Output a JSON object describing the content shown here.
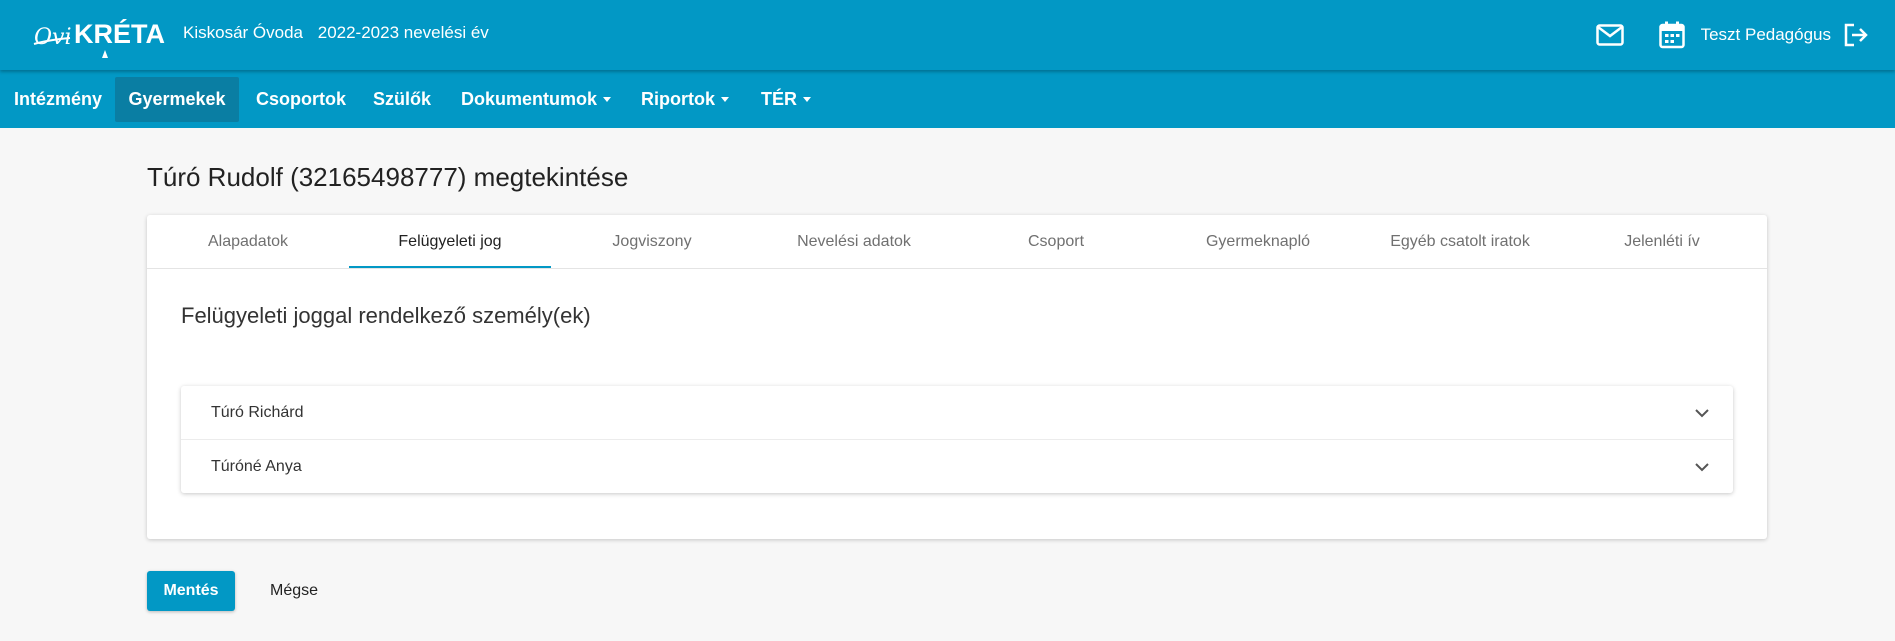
{
  "header": {
    "logo_text": "OviKRÉTA",
    "institution": "Kiskosár Óvoda",
    "school_year": "2022-2023 nevelési év",
    "user_name": "Teszt Pedagógus",
    "icons": [
      "mail-icon",
      "calendar-icon",
      "logout-icon"
    ]
  },
  "nav": {
    "items": [
      {
        "label": "Intézmény"
      },
      {
        "label": "Gyermekek",
        "active": true
      },
      {
        "label": "Csoportok"
      },
      {
        "label": "Szülők"
      },
      {
        "label": "Dokumentumok",
        "dropdown": true
      },
      {
        "label": "Riportok",
        "dropdown": true
      },
      {
        "label": "TÉR",
        "dropdown": true
      }
    ]
  },
  "page": {
    "title": "Túró Rudolf (32165498777) megtekintése"
  },
  "tabs": [
    {
      "label": "Alapadatok"
    },
    {
      "label": "Felügyeleti jog",
      "active": true
    },
    {
      "label": "Jogviszony"
    },
    {
      "label": "Nevelési adatok"
    },
    {
      "label": "Csoport"
    },
    {
      "label": "Gyermeknapló"
    },
    {
      "label": "Egyéb csatolt iratok"
    },
    {
      "label": "Jelenléti ív"
    }
  ],
  "section": {
    "title": "Felügyeleti joggal rendelkező személy(ek)",
    "persons": [
      {
        "name": "Túró Richárd"
      },
      {
        "name": "Túróné Anya"
      }
    ]
  },
  "actions": {
    "save_label": "Mentés",
    "cancel_label": "Mégse"
  },
  "colors": {
    "primary": "#0298c5",
    "nav_active": "#0a7ea3",
    "background": "#f7f7f7"
  }
}
